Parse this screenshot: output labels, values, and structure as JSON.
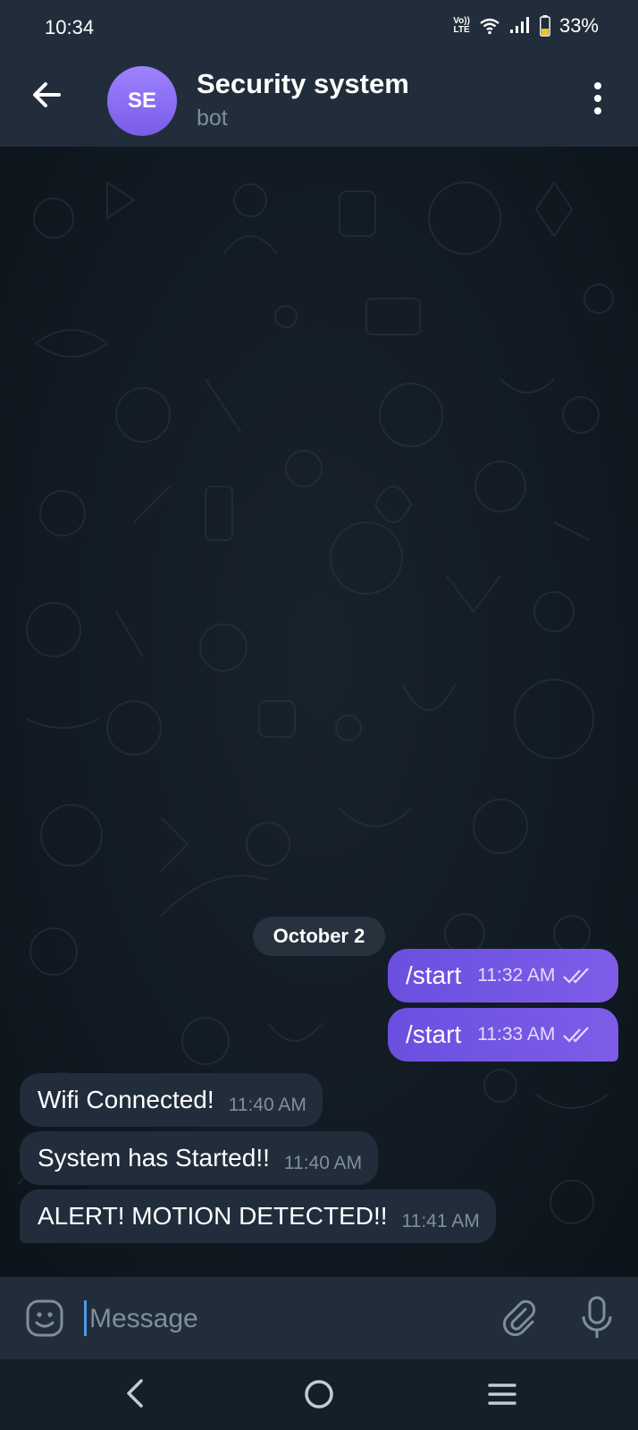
{
  "status_bar": {
    "time": "10:34",
    "network_top": "Vo))",
    "network_bottom": "LTE",
    "battery": "33%"
  },
  "header": {
    "avatar_initials": "SE",
    "title": "Security system",
    "subtitle": "bot"
  },
  "chat": {
    "date_separator": "October 2",
    "outgoing": [
      {
        "text": "/start",
        "time": "11:32 AM"
      },
      {
        "text": "/start",
        "time": "11:33 AM"
      }
    ],
    "incoming": [
      {
        "text": "Wifi Connected!",
        "time": "11:40 AM"
      },
      {
        "text": "System has Started!!",
        "time": "11:40 AM"
      },
      {
        "text": "ALERT! MOTION DETECTED!!",
        "time": "11:41 AM"
      }
    ]
  },
  "composer": {
    "placeholder": "Message"
  },
  "colors": {
    "header_bg": "#212d3b",
    "outgoing_bubble": "#7456e4",
    "incoming_bubble": "#212d3b",
    "accent": "#4f9be8"
  },
  "icons": [
    "back-arrow-icon",
    "more-vertical-icon",
    "emoji-icon",
    "attach-icon",
    "mic-icon",
    "double-check-icon",
    "wifi-icon",
    "signal-icon",
    "battery-icon",
    "nav-back-icon",
    "nav-home-icon",
    "nav-recent-icon"
  ]
}
